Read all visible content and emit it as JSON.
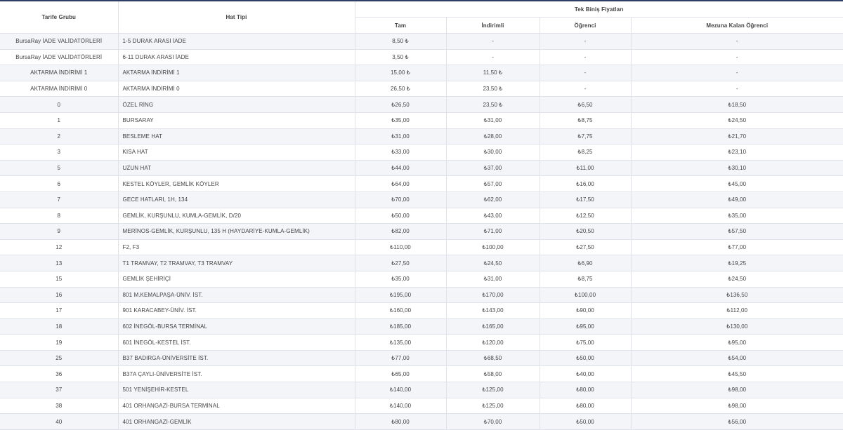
{
  "headers": {
    "tarife_grubu": "Tarife Grubu",
    "hat_tipi": "Hat Tipi",
    "group": "Tek Biniş Fiyatları",
    "tam": "Tam",
    "indirimli": "İndirimli",
    "ogrenci": "Öğrenci",
    "mezuna": "Mezuna Kalan Öğrenci"
  },
  "rows": [
    {
      "grup": "BursaRay İADE VALİDATÖRLERİ",
      "hat": "1-5 DURAK ARASI İADE",
      "tam": "8,50 ₺",
      "ind": "-",
      "ogr": "-",
      "mez": "-"
    },
    {
      "grup": "BursaRay İADE VALİDATÖRLERİ",
      "hat": "6-11 DURAK ARASI İADE",
      "tam": "3,50 ₺",
      "ind": "-",
      "ogr": "-",
      "mez": "-"
    },
    {
      "grup": "AKTARMA İNDİRİMİ 1",
      "hat": "AKTARMA İNDİRİMİ 1",
      "tam": "15,00 ₺",
      "ind": "11,50 ₺",
      "ogr": "-",
      "mez": "-"
    },
    {
      "grup": "AKTARMA İNDİRİMİ 0",
      "hat": "AKTARMA İNDİRİMİ 0",
      "tam": "26,50 ₺",
      "ind": "23,50 ₺",
      "ogr": "-",
      "mez": "-"
    },
    {
      "grup": "0",
      "hat": "ÖZEL RİNG",
      "tam": "₺26,50",
      "ind": "23,50 ₺",
      "ogr": "₺6,50",
      "mez": "₺18,50"
    },
    {
      "grup": "1",
      "hat": "BURSARAY",
      "tam": "₺35,00",
      "ind": "₺31,00",
      "ogr": "₺8,75",
      "mez": "₺24,50"
    },
    {
      "grup": "2",
      "hat": "BESLEME HAT",
      "tam": "₺31,00",
      "ind": "₺28,00",
      "ogr": "₺7,75",
      "mez": "₺21,70"
    },
    {
      "grup": "3",
      "hat": "KISA HAT",
      "tam": "₺33,00",
      "ind": "₺30,00",
      "ogr": "₺8,25",
      "mez": "₺23,10"
    },
    {
      "grup": "5",
      "hat": "UZUN HAT",
      "tam": "₺44,00",
      "ind": "₺37,00",
      "ogr": "₺11,00",
      "mez": "₺30,10"
    },
    {
      "grup": "6",
      "hat": "KESTEL KÖYLER, GEMLİK KÖYLER",
      "tam": "₺64,00",
      "ind": "₺57,00",
      "ogr": "₺16,00",
      "mez": "₺45,00"
    },
    {
      "grup": "7",
      "hat": "GECE HATLARI, 1H, 134",
      "tam": "₺70,00",
      "ind": "₺62,00",
      "ogr": "₺17,50",
      "mez": "₺49,00"
    },
    {
      "grup": "8",
      "hat": "GEMLİK, KURŞUNLU, KUMLA-GEMLİK, D/20",
      "tam": "₺50,00",
      "ind": "₺43,00",
      "ogr": "₺12,50",
      "mez": "₺35,00"
    },
    {
      "grup": "9",
      "hat": "MERİNOS-GEMLİK, KURŞUNLU, 135 H (HAYDARİYE-KUMLA-GEMLİK)",
      "tam": "₺82,00",
      "ind": "₺71,00",
      "ogr": "₺20,50",
      "mez": "₺57,50"
    },
    {
      "grup": "12",
      "hat": "F2, F3",
      "tam": "₺110,00",
      "ind": "₺100,00",
      "ogr": "₺27,50",
      "mez": "₺77,00"
    },
    {
      "grup": "13",
      "hat": "T1 TRAMVAY, T2 TRAMVAY, T3 TRAMVAY",
      "tam": "₺27,50",
      "ind": "₺24,50",
      "ogr": "₺6,90",
      "mez": "₺19,25"
    },
    {
      "grup": "15",
      "hat": "GEMLİK ŞEHİRİÇİ",
      "tam": "₺35,00",
      "ind": "₺31,00",
      "ogr": "₺8,75",
      "mez": "₺24,50"
    },
    {
      "grup": "16",
      "hat": "801 M.KEMALPAŞA-ÜNİV. İST.",
      "tam": "₺195,00",
      "ind": "₺170,00",
      "ogr": "₺100,00",
      "mez": "₺136,50"
    },
    {
      "grup": "17",
      "hat": "901 KARACABEY-ÜNİV. İST.",
      "tam": "₺160,00",
      "ind": "₺143,00",
      "ogr": "₺90,00",
      "mez": "₺112,00"
    },
    {
      "grup": "18",
      "hat": "602 İNEGÖL-BURSA TERMİNAL",
      "tam": "₺185,00",
      "ind": "₺165,00",
      "ogr": "₺95,00",
      "mez": "₺130,00"
    },
    {
      "grup": "19",
      "hat": "601 İNEGÖL-KESTEL İST.",
      "tam": "₺135,00",
      "ind": "₺120,00",
      "ogr": "₺75,00",
      "mez": "₺95,00"
    },
    {
      "grup": "25",
      "hat": "B37 BADIRGA-ÜNİVERSİTE İST.",
      "tam": "₺77,00",
      "ind": "₺68,50",
      "ogr": "₺50,00",
      "mez": "₺54,00"
    },
    {
      "grup": "36",
      "hat": "B37A ÇAYLI-ÜNİVERSİTE İST.",
      "tam": "₺65,00",
      "ind": "₺58,00",
      "ogr": "₺40,00",
      "mez": "₺45,50"
    },
    {
      "grup": "37",
      "hat": "501 YENİŞEHİR-KESTEL",
      "tam": "₺140,00",
      "ind": "₺125,00",
      "ogr": "₺80,00",
      "mez": "₺98,00"
    },
    {
      "grup": "38",
      "hat": "401 ORHANGAZİ-BURSA TERMİNAL",
      "tam": "₺140,00",
      "ind": "₺125,00",
      "ogr": "₺80,00",
      "mez": "₺98,00"
    },
    {
      "grup": "40",
      "hat": "401 ORHANGAZİ-GEMLİK",
      "tam": "₺80,00",
      "ind": "₺70,00",
      "ogr": "₺50,00",
      "mez": "₺56,00"
    }
  ]
}
